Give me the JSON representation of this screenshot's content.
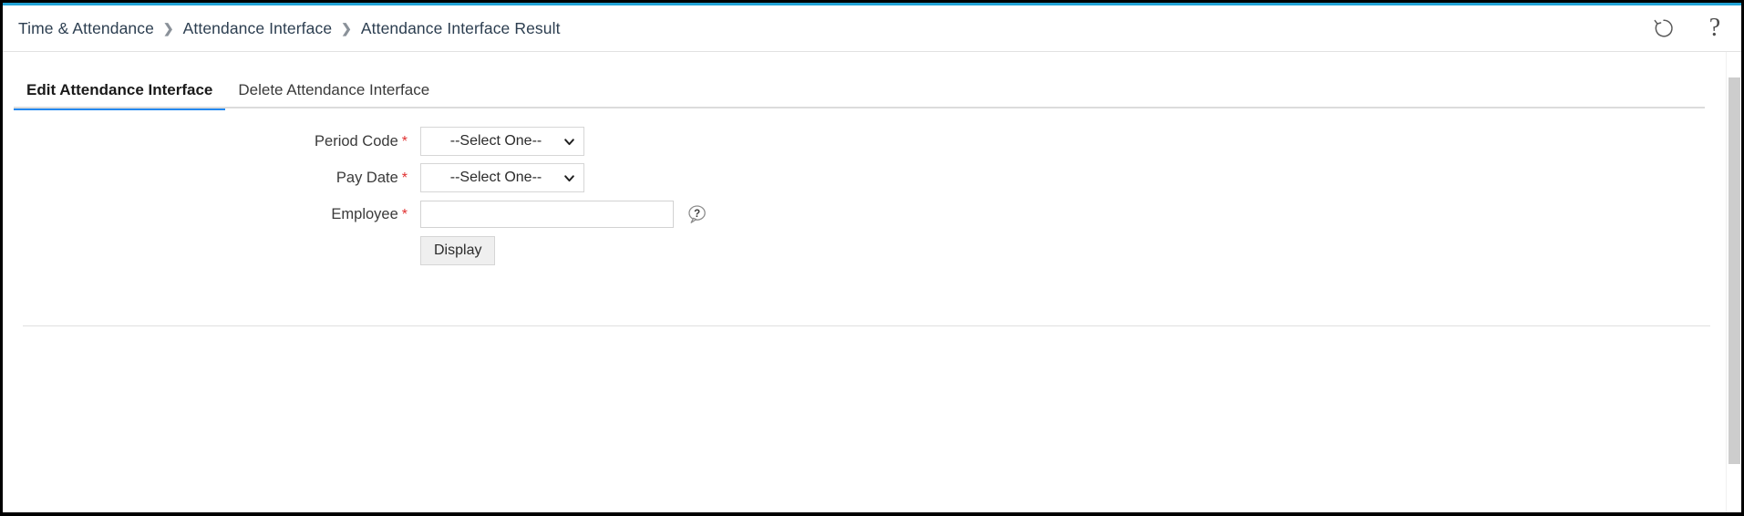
{
  "window": {
    "accent_color": "#22a3d6",
    "border_color": "#000000"
  },
  "header": {
    "breadcrumb": [
      {
        "label": "Time & Attendance"
      },
      {
        "label": "Attendance Interface"
      },
      {
        "label": "Attendance Interface Result"
      }
    ],
    "separator": "❯",
    "actions": [
      {
        "name": "history-icon",
        "title": "History"
      },
      {
        "name": "help-icon",
        "title": "Help",
        "glyph": "?"
      }
    ]
  },
  "tabs": {
    "active_color": "#2388f0",
    "items": [
      {
        "label": "Edit Attendance Interface",
        "active": true
      },
      {
        "label": "Delete Attendance Interface",
        "active": false
      }
    ]
  },
  "form": {
    "fields": [
      {
        "label": "Period Code",
        "required": true,
        "required_marker": "*",
        "type": "select",
        "value": "--Select One--"
      },
      {
        "label": "Pay Date",
        "required": true,
        "required_marker": "*",
        "type": "select",
        "value": "--Select One--"
      },
      {
        "label": "Employee",
        "required": true,
        "required_marker": "*",
        "type": "text",
        "value": "",
        "placeholder": "",
        "help": "?"
      }
    ],
    "submit_button": "Display"
  }
}
